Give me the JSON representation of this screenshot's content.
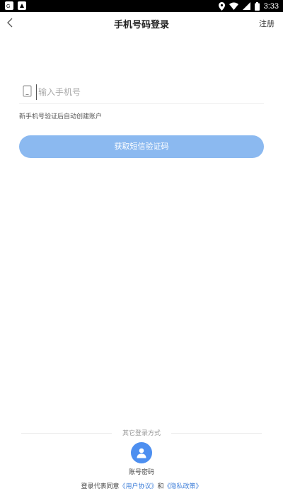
{
  "status_bar": {
    "time": "3:33",
    "icons": [
      "app-notification-icon",
      "app-notification-icon-2",
      "location-icon",
      "wifi-icon",
      "signal-icon",
      "battery-icon"
    ]
  },
  "header": {
    "title": "手机号码登录",
    "register_label": "注册",
    "back_icon": "chevron-left-icon"
  },
  "form": {
    "phone_placeholder": "输入手机号",
    "phone_value": "",
    "phone_icon": "phone-icon",
    "hint": "新手机号验证后自动创建账户",
    "submit_label": "获取短信验证码"
  },
  "other_login": {
    "title": "其它登录方式",
    "account_label": "账号密码",
    "account_icon": "user-icon"
  },
  "agreement": {
    "prefix": "登录代表同意",
    "user_agreement": "《用户协议》",
    "conjunction": "和",
    "privacy_policy": "《隐私政策》"
  },
  "colors": {
    "accent": "#4d8ff0",
    "button_disabled": "#8bb9f0",
    "link": "#3f7fd9"
  }
}
